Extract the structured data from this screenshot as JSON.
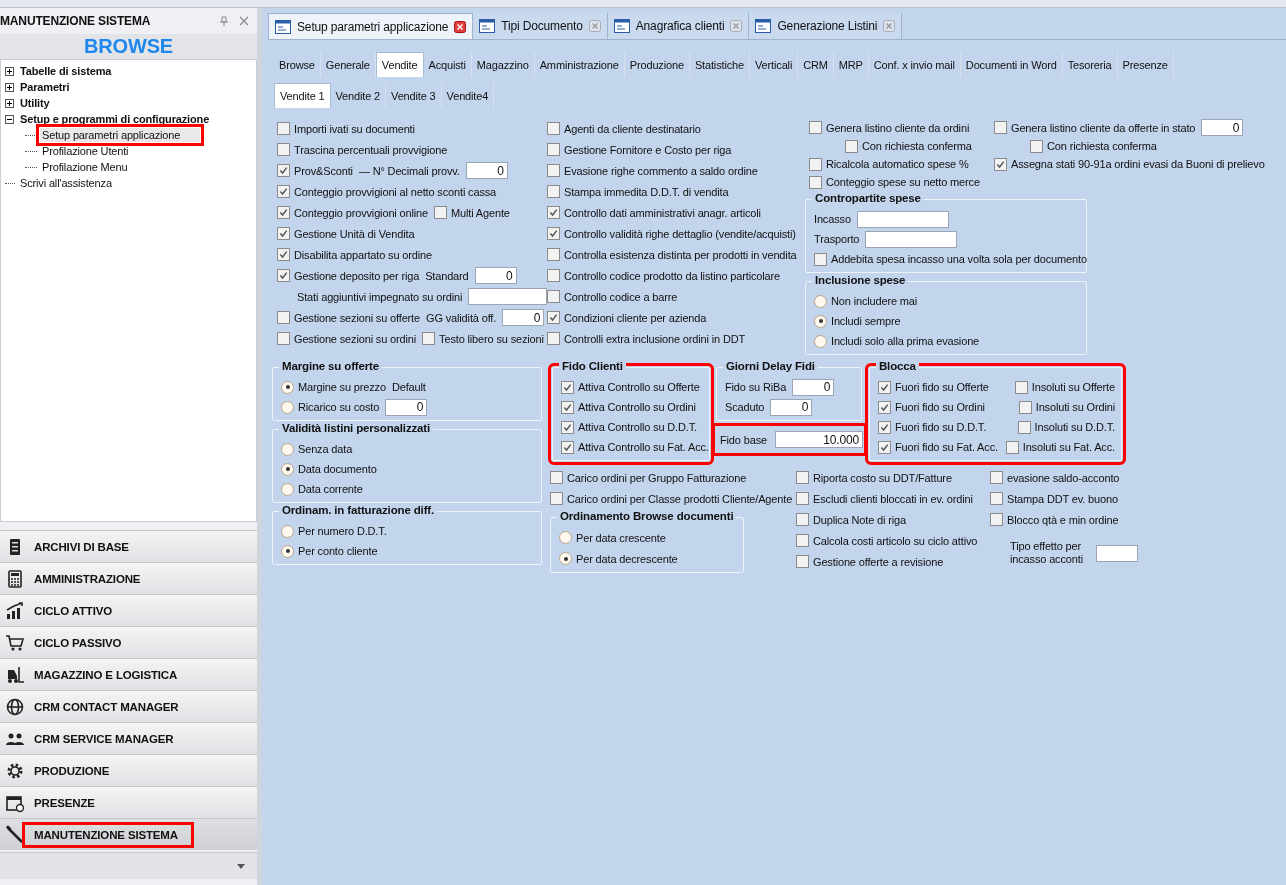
{
  "panel": {
    "title": "MANUTENZIONE SISTEMA",
    "browse_label": "BROWSE"
  },
  "tree": [
    {
      "label": "Tabelle di sistema",
      "kind": "folder",
      "expanded": false,
      "selected": false,
      "highlighted": false
    },
    {
      "label": "Parametri",
      "kind": "folder",
      "expanded": false,
      "selected": false,
      "highlighted": false
    },
    {
      "label": "Utility",
      "kind": "folder",
      "expanded": false,
      "selected": false,
      "highlighted": false
    },
    {
      "label": "Setup e programmi di configurazione",
      "kind": "folder",
      "expanded": true,
      "selected": false,
      "highlighted": false,
      "children": [
        {
          "label": "Setup parametri applicazione",
          "selected": true,
          "highlighted": true
        },
        {
          "label": "Profilazione Utenti",
          "selected": false,
          "highlighted": false
        },
        {
          "label": "Profilazione Menu",
          "selected": false,
          "highlighted": false
        }
      ]
    },
    {
      "label": "Scrivi all'assistenza",
      "kind": "leaf",
      "selected": false,
      "highlighted": false
    }
  ],
  "nav": [
    {
      "label": "ARCHIVI DI BASE",
      "kind": "server",
      "selected": false,
      "highlighted": false
    },
    {
      "label": "AMMINISTRAZIONE",
      "kind": "calculator",
      "selected": false,
      "highlighted": false
    },
    {
      "label": "CICLO ATTIVO",
      "kind": "bar-chart",
      "selected": false,
      "highlighted": false
    },
    {
      "label": "CICLO PASSIVO",
      "kind": "cart",
      "selected": false,
      "highlighted": false
    },
    {
      "label": "MAGAZZINO E LOGISTICA",
      "kind": "forklift",
      "selected": false,
      "highlighted": false
    },
    {
      "label": "CRM CONTACT MANAGER",
      "kind": "globe",
      "selected": false,
      "highlighted": false
    },
    {
      "label": "CRM SERVICE MANAGER",
      "kind": "people",
      "selected": false,
      "highlighted": false
    },
    {
      "label": "PRODUZIONE",
      "kind": "gear",
      "selected": false,
      "highlighted": false
    },
    {
      "label": "PRESENZE",
      "kind": "calendar",
      "selected": false,
      "highlighted": false
    },
    {
      "label": "MANUTENZIONE SISTEMA",
      "kind": "wrench",
      "selected": true,
      "highlighted": true
    }
  ],
  "doc_tabs": [
    {
      "label": "Setup parametri applicazione",
      "selected": true
    },
    {
      "label": "Tipi Documento",
      "selected": false
    },
    {
      "label": "Anagrafica clienti",
      "selected": false
    },
    {
      "label": "Generazione Listini",
      "selected": false
    }
  ],
  "tabs": [
    {
      "label": "Browse",
      "selected": false
    },
    {
      "label": "Generale",
      "selected": false
    },
    {
      "label": "Vendite",
      "selected": true
    },
    {
      "label": "Acquisti",
      "selected": false
    },
    {
      "label": "Magazzino",
      "selected": false
    },
    {
      "label": "Amministrazione",
      "selected": false
    },
    {
      "label": "Produzione",
      "selected": false
    },
    {
      "label": "Statistiche",
      "selected": false
    },
    {
      "label": "Verticali",
      "selected": false
    },
    {
      "label": "CRM",
      "selected": false
    },
    {
      "label": "MRP",
      "selected": false
    },
    {
      "label": "Conf. x invio mail",
      "selected": false
    },
    {
      "label": "Documenti in Word",
      "selected": false
    },
    {
      "label": "Tesoreria",
      "selected": false
    },
    {
      "label": "Presenze",
      "selected": false
    }
  ],
  "subtabs": [
    {
      "label": "Vendite 1",
      "selected": true
    },
    {
      "label": "Vendite 2",
      "selected": false
    },
    {
      "label": "Vendite 3",
      "selected": false
    },
    {
      "label": "Vendite4",
      "selected": false
    }
  ],
  "form": {
    "col_a": [
      {
        "parts": [
          {
            "kind": "check",
            "label": "Importi ivati su documenti",
            "checked": false
          }
        ]
      },
      {
        "parts": [
          {
            "kind": "check",
            "label": "Trascina percentuali provvigione",
            "checked": false
          }
        ]
      },
      {
        "parts": [
          {
            "kind": "check",
            "label": "Prov&Sconti",
            "checked": true
          },
          {
            "kind": "label",
            "text": "— N° Decimali provv."
          },
          {
            "kind": "input",
            "value": "0"
          }
        ]
      },
      {
        "parts": [
          {
            "kind": "check",
            "label": "Conteggio provvigioni al netto sconti cassa",
            "checked": true
          }
        ]
      },
      {
        "parts": [
          {
            "kind": "check",
            "label": "Conteggio provvigioni online",
            "checked": true
          },
          {
            "kind": "check",
            "label": "Multi Agente",
            "checked": false
          }
        ]
      },
      {
        "parts": [
          {
            "kind": "check",
            "label": "Gestione Unità di Vendita",
            "checked": true
          }
        ]
      },
      {
        "parts": [
          {
            "kind": "check",
            "label": "Disabilita appartato su ordine",
            "checked": true
          }
        ]
      },
      {
        "parts": [
          {
            "kind": "check",
            "label": "Gestione deposito per riga",
            "checked": true
          },
          {
            "kind": "label",
            "text": "Standard"
          },
          {
            "kind": "input",
            "value": "0"
          }
        ]
      },
      {
        "parts": [
          {
            "kind": "label",
            "text": "Stati aggiuntivi impegnato su ordini"
          },
          {
            "kind": "field"
          }
        ]
      },
      {
        "parts": [
          {
            "kind": "check",
            "label": "Gestione sezioni su offerte",
            "checked": false
          },
          {
            "kind": "label",
            "text": "GG validità off."
          },
          {
            "kind": "input",
            "value": "0"
          }
        ]
      },
      {
        "parts": [
          {
            "kind": "check",
            "label": "Gestione sezioni su ordini",
            "checked": false
          },
          {
            "kind": "check",
            "label": "Testo libero su sezioni",
            "checked": false
          }
        ]
      }
    ],
    "col_b": [
      {
        "kind": "check",
        "label": "Agenti da cliente destinatario",
        "checked": false
      },
      {
        "kind": "check",
        "label": "Gestione Fornitore e Costo per riga",
        "checked": false
      },
      {
        "kind": "check",
        "label": "Evasione righe commento a saldo ordine",
        "checked": false
      },
      {
        "kind": "check",
        "label": "Stampa immedita D.D.T. di vendita",
        "checked": false
      },
      {
        "kind": "check",
        "label": "Controllo dati amministrativi anagr. articoli",
        "checked": true
      },
      {
        "kind": "check",
        "label": "Controllo validità righe dettaglio (vendite/acquisti)",
        "checked": true
      },
      {
        "kind": "check",
        "label": "Controlla esistenza distinta per prodotti in vendita",
        "checked": false
      },
      {
        "kind": "check",
        "label": "Controllo codice prodotto da listino particolare",
        "checked": false
      },
      {
        "kind": "check",
        "label": "Controllo codice a barre",
        "checked": false
      },
      {
        "kind": "check",
        "label": "Condizioni cliente per azienda",
        "checked": true
      },
      {
        "kind": "check",
        "label": "Controlli extra inclusione ordini in DDT",
        "checked": false
      }
    ],
    "col_c": [
      {
        "cells": [
          [
            {
              "kind": "check",
              "label": "Genera listino cliente da ordini",
              "checked": false
            }
          ],
          [
            {
              "kind": "check",
              "label": "Genera listino cliente da offerte in stato",
              "checked": false
            },
            {
              "kind": "input",
              "value": "0"
            }
          ]
        ]
      },
      {
        "cells": [
          [
            {
              "kind": "subcheck",
              "label": "Con richiesta conferma",
              "checked": false
            }
          ],
          [
            {
              "kind": "subcheck",
              "label": "Con richiesta conferma",
              "checked": false
            }
          ]
        ]
      },
      {
        "cells": [
          [
            {
              "kind": "check",
              "label": "Ricalcola automatico spese %",
              "checked": false
            }
          ],
          [
            {
              "kind": "check",
              "label": "Assegna stati 90-91a ordini evasi da Buoni di prelievo",
              "checked": true
            }
          ]
        ]
      },
      {
        "cells": [
          [
            {
              "kind": "check",
              "label": "Conteggio spese su netto merce",
              "checked": false
            }
          ]
        ]
      }
    ],
    "contropartite": {
      "title": "Contropartite spese",
      "highlighted": false,
      "rows": [
        {
          "parts": [
            {
              "kind": "label",
              "text": "Incasso"
            },
            {
              "kind": "field"
            }
          ]
        },
        {
          "parts": [
            {
              "kind": "label",
              "text": "Trasporto"
            },
            {
              "kind": "field"
            }
          ]
        },
        {
          "parts": [
            {
              "kind": "check",
              "label": "Addebita spesa incasso una volta sola per documento",
              "checked": false
            }
          ]
        }
      ]
    },
    "inclusione": {
      "title": "Inclusione spese",
      "highlighted": false,
      "rows": [
        {
          "parts": [
            {
              "kind": "radio",
              "label": "Non includere mai",
              "selected": false
            }
          ]
        },
        {
          "parts": [
            {
              "kind": "radio",
              "label": "Includi sempre",
              "selected": true
            }
          ]
        },
        {
          "parts": [
            {
              "kind": "radio",
              "label": "Includi solo alla prima evasione",
              "selected": false
            }
          ]
        }
      ]
    },
    "margine": {
      "title": "Margine su offerte",
      "highlighted": false,
      "rows": [
        {
          "parts": [
            {
              "kind": "radio",
              "label": "Margine su prezzo",
              "selected": true
            },
            {
              "kind": "label",
              "text": "Default"
            }
          ]
        },
        {
          "parts": [
            {
              "kind": "radio",
              "label": "Ricarico su costo",
              "selected": false
            },
            {
              "kind": "input",
              "value": "0"
            }
          ]
        }
      ]
    },
    "validita": {
      "title": "Validità listini personalizzati",
      "highlighted": false,
      "rows": [
        {
          "parts": [
            {
              "kind": "radio",
              "label": "Senza data",
              "selected": false
            }
          ]
        },
        {
          "parts": [
            {
              "kind": "radio",
              "label": "Data documento",
              "selected": true
            }
          ]
        },
        {
          "parts": [
            {
              "kind": "radio",
              "label": "Data corrente",
              "selected": false
            }
          ]
        }
      ]
    },
    "ordinam": {
      "title": "Ordinam. in fatturazione diff.",
      "highlighted": false,
      "rows": [
        {
          "parts": [
            {
              "kind": "radio",
              "label": "Per numero D.D.T.",
              "selected": false
            }
          ]
        },
        {
          "parts": [
            {
              "kind": "radio",
              "label": "Per conto cliente",
              "selected": true
            }
          ]
        }
      ]
    },
    "fido_clienti": {
      "title": "Fido Clienti",
      "highlighted": true,
      "rows": [
        {
          "parts": [
            {
              "kind": "check",
              "label": "Attiva Controllo su Offerte",
              "checked": true
            }
          ]
        },
        {
          "parts": [
            {
              "kind": "check",
              "label": "Attiva Controllo su Ordini",
              "checked": true
            }
          ]
        },
        {
          "parts": [
            {
              "kind": "check",
              "label": "Attiva Controllo su D.D.T.",
              "checked": true
            }
          ]
        },
        {
          "parts": [
            {
              "kind": "check",
              "label": "Attiva Controllo su Fat. Acc.",
              "checked": true
            }
          ]
        }
      ]
    },
    "giorni": {
      "title": "Giorni Delay Fidi",
      "highlighted": false,
      "rows": [
        {
          "parts": [
            {
              "kind": "label",
              "text": "Fido su RiBa"
            },
            {
              "kind": "input",
              "value": "0"
            }
          ]
        },
        {
          "parts": [
            {
              "kind": "label",
              "text": "Scaduto"
            },
            {
              "kind": "input",
              "value": "0"
            }
          ]
        }
      ]
    },
    "fido_base": {
      "label": "Fido base",
      "value": "10.000",
      "highlighted": true
    },
    "blocca": {
      "title": "Blocca",
      "highlighted": true,
      "rows": [
        {
          "parts": [
            {
              "kind": "check",
              "label": "Fuori fido su Offerte",
              "checked": true
            },
            {
              "kind": "check",
              "label": "Insoluti su Offerte",
              "checked": false
            }
          ]
        },
        {
          "parts": [
            {
              "kind": "check",
              "label": "Fuori fido su Ordini",
              "checked": true
            },
            {
              "kind": "check",
              "label": "Insoluti su Ordini",
              "checked": false
            }
          ]
        },
        {
          "parts": [
            {
              "kind": "check",
              "label": "Fuori fido su D.D.T.",
              "checked": true
            },
            {
              "kind": "check",
              "label": "Insoluti su D.D.T.",
              "checked": false
            }
          ]
        },
        {
          "parts": [
            {
              "kind": "check",
              "label": "Fuori fido su Fat. Acc.",
              "checked": true
            },
            {
              "kind": "check",
              "label": "Insoluti su Fat. Acc.",
              "checked": false
            }
          ]
        }
      ]
    },
    "carico": [
      {
        "kind": "check",
        "label": "Carico ordini per Gruppo Fatturazione",
        "checked": false
      },
      {
        "kind": "check",
        "label": "Carico ordini per Classe prodotti Cliente/Agente",
        "checked": false
      }
    ],
    "ordinamento": {
      "title": "Ordinamento Browse documenti",
      "highlighted": false,
      "rows": [
        {
          "parts": [
            {
              "kind": "radio",
              "label": "Per data crescente",
              "selected": false
            }
          ]
        },
        {
          "parts": [
            {
              "kind": "radio",
              "label": "Per data decrescente",
              "selected": true
            }
          ]
        }
      ]
    },
    "mid": [
      {
        "kind": "check",
        "label": "Riporta costo su DDT/Fatture",
        "checked": false
      },
      {
        "kind": "check",
        "label": "Escludi clienti bloccati in ev. ordini",
        "checked": false
      },
      {
        "kind": "check",
        "label": "Duplica Note di riga",
        "checked": false
      },
      {
        "kind": "check",
        "label": "Calcola costi articolo su ciclo attivo",
        "checked": false
      },
      {
        "kind": "check",
        "label": "Gestione offerte a revisione",
        "checked": false
      }
    ],
    "right": [
      {
        "kind": "check",
        "label": "evasione saldo-acconto",
        "checked": false
      },
      {
        "kind": "check",
        "label": "Stampa DDT ev. buono",
        "checked": false
      },
      {
        "kind": "check",
        "label": "Blocco qtà e min ordine",
        "checked": false
      }
    ],
    "tipo_effetto": {
      "label": "Tipo effetto per incasso acconti"
    }
  }
}
